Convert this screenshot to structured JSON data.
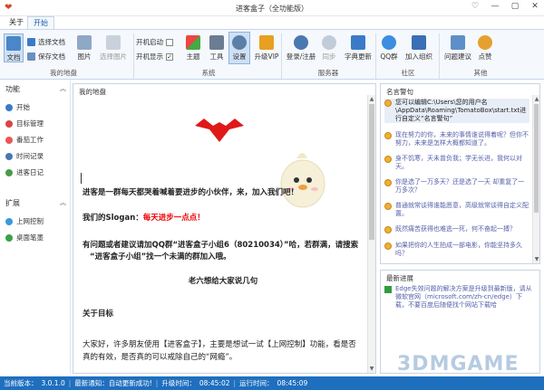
{
  "window": {
    "title": "进客盒子（全功能版）",
    "controls": [
      "♡",
      "—",
      "▢",
      "✕"
    ]
  },
  "tabs": [
    "关于",
    "开始"
  ],
  "ribbon": {
    "doc_big": "文档",
    "doc_select": "选择文档",
    "doc_save": "保存文档",
    "image": "图片",
    "select_image": "选择图片",
    "boot_start": "开机启动",
    "boot_show": "开机显示",
    "theme": "主题",
    "tools": "工具",
    "settings": "设置",
    "upgrade_vip": "升级VIP",
    "login_register": "登录/注册",
    "sync": "同步",
    "dict_update": "字典更新",
    "qq_group": "QQ群",
    "join_org": "加入组织",
    "feedback": "问题建议",
    "like": "点赞",
    "groups": {
      "my_space": "我的地盘",
      "system": "系统",
      "server": "服务器",
      "community": "社区",
      "other": "其他"
    }
  },
  "sidebar": {
    "function_head": "功能",
    "items": [
      "开始",
      "目标管理",
      "番茄工作",
      "时间记录",
      "进客日记"
    ],
    "extend_head": "扩展",
    "ext_items": [
      "上网控制",
      "桌面笔墨"
    ]
  },
  "main": {
    "panel_title": "我的地盘",
    "line1": "进客是一群每天都哭着喊着要进步的小伙伴，来，加入我们吧！",
    "slogan_prefix": "我们的Slogan：",
    "slogan": "每天进步一点点！",
    "qq_line1": "有问题或者建议请加QQ群“进客盒子小组6（80210034）”哈，若群满，请搜索",
    "qq_line2": "“进客盒子小组”找一个未满的群加入哦。",
    "sign": "老六想给大家说几句",
    "about_goal": "关于目标",
    "para1": "大家好，许多朋友使用【进客盒子】，主要是想试一试【上网控制】功能，看是否",
    "para2": "真的有效，是否真的可以戒除自己的“网瘾”。"
  },
  "quotes": {
    "title": "名言警句",
    "items": [
      "您可以编辑C:\\Users\\您的用户名\\AppData\\Roaming\\TomatoBox\\start.txt进行自定义“名言警句”",
      "现在努力的你，未来的事情谁说得着呢？但你不努力，未来是怎样大概都知道了。",
      "身不饥寒，天未曾负我；学无长进，我何以对天。",
      "你是选了一万多天？还是选了一天 却重复了一万多次？",
      "普通就常谈得谁能愿意，高级就常谈得自定义配置。",
      "既然痛苦获得也难逃一死，何不奋起一搏？",
      "如果把你的人生拍成一部电影，你能坚持多久吗？"
    ]
  },
  "news": {
    "title": "最新进展",
    "items": [
      "Edge失效问题的解决方案是升级到最新版，请从微软官网（microsoft.com/zh-cn/edge）下载，不要百度后随便找个网站下载哈"
    ]
  },
  "status": {
    "version_label": "当前版本：",
    "version": "3.0.1.0",
    "latest": "最新通知：自动更新成功!",
    "upgrade_label": "升级时间：",
    "upgrade_time": "08:45:02",
    "run_label": "运行时间：",
    "run_time": "08:45:09"
  },
  "watermark": "3DMGAME",
  "colors": {
    "accent": "#1f6fbf",
    "red": "#e00000",
    "logo": "#e01818"
  }
}
